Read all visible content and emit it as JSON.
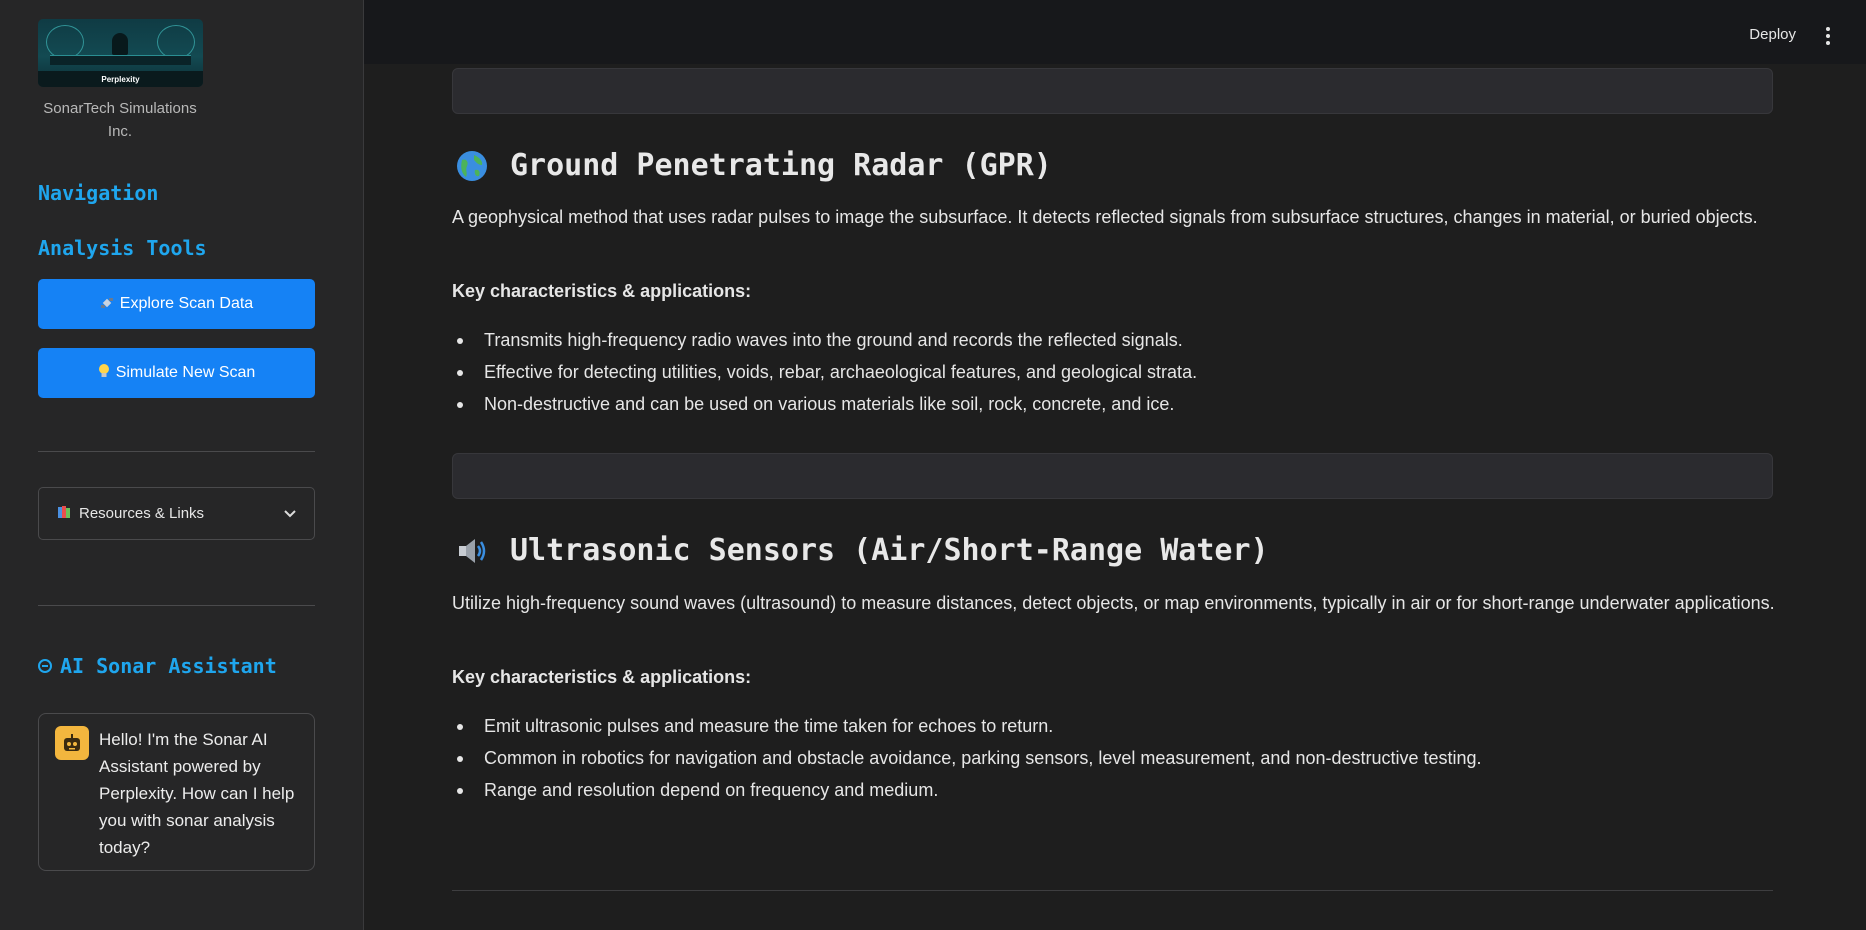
{
  "sidebar": {
    "logo_text": "Perplexity",
    "company": "SonarTech Simulations Inc.",
    "nav_title": "Navigation",
    "tools_title": "Analysis Tools",
    "explore_button": "Explore Scan Data",
    "simulate_button": "Simulate New Scan",
    "resources_expander": "Resources & Links",
    "assistant_title": "AI Sonar Assistant",
    "assistant_message": "Hello! I'm the Sonar AI Assistant powered by Perplexity. How can I help you with sonar analysis today?"
  },
  "header": {
    "deploy": "Deploy"
  },
  "sections": [
    {
      "title": "Ground Penetrating Radar (GPR)",
      "icon": "globe-icon",
      "description": "A geophysical method that uses radar pulses to image the subsurface. It detects reflected signals from subsurface structures, changes in material, or buried objects.",
      "key_label": "Key characteristics & applications:",
      "bullets": [
        "Transmits high-frequency radio waves into the ground and records the reflected signals.",
        "Effective for detecting utilities, voids, rebar, archaeological features, and geological strata.",
        "Non-destructive and can be used on various materials like soil, rock, concrete, and ice."
      ]
    },
    {
      "title": "Ultrasonic Sensors (Air/Short-Range Water)",
      "icon": "speaker-icon",
      "description": "Utilize high-frequency sound waves (ultrasound) to measure distances, detect objects, or map environments, typically in air or for short-range underwater applications.",
      "key_label": "Key characteristics & applications:",
      "bullets": [
        "Emit ultrasonic pulses and measure the time taken for echoes to return.",
        "Common in robotics for navigation and obstacle avoidance, parking sensors, level measurement, and non-destructive testing.",
        "Range and resolution depend on frequency and medium."
      ]
    }
  ],
  "colors": {
    "accent": "#1fa6ee",
    "button": "#1582f5",
    "bot_avatar": "#f3b63e"
  }
}
